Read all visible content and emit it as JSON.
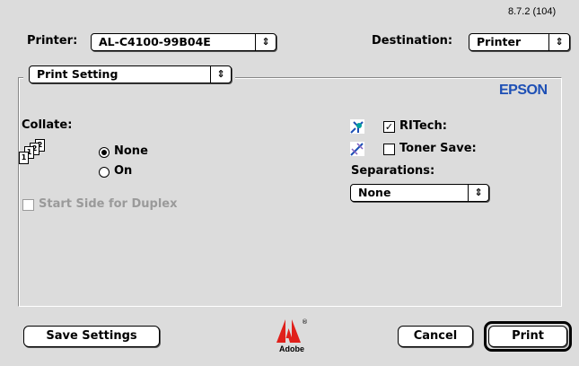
{
  "version": "8.7.2 (104)",
  "printer": {
    "label": "Printer:",
    "value": "AL-C4100-99B04E"
  },
  "destination": {
    "label": "Destination:",
    "value": "Printer"
  },
  "panel": {
    "value": "Print Setting"
  },
  "brand": "EPSON",
  "collate": {
    "label": "Collate:",
    "options": [
      {
        "label": "None",
        "selected": true
      },
      {
        "label": "On",
        "selected": false
      }
    ]
  },
  "duplex": {
    "label": "Start Side for Duplex",
    "checked": false,
    "enabled": false
  },
  "ritech": {
    "label": "RITech:",
    "checked": true
  },
  "toner_save": {
    "label": "Toner Save:",
    "checked": false
  },
  "separations": {
    "label": "Separations:",
    "value": "None"
  },
  "buttons": {
    "save": "Save Settings",
    "cancel": "Cancel",
    "print": "Print"
  },
  "adobe": {
    "text": "Adobe"
  },
  "icons": {
    "popup_arrows": "updown-arrows-icon",
    "collate": "collate-pages-icon",
    "ritech": "ritech-icon",
    "toner_save": "toner-save-icon",
    "adobe": "adobe-logo"
  }
}
